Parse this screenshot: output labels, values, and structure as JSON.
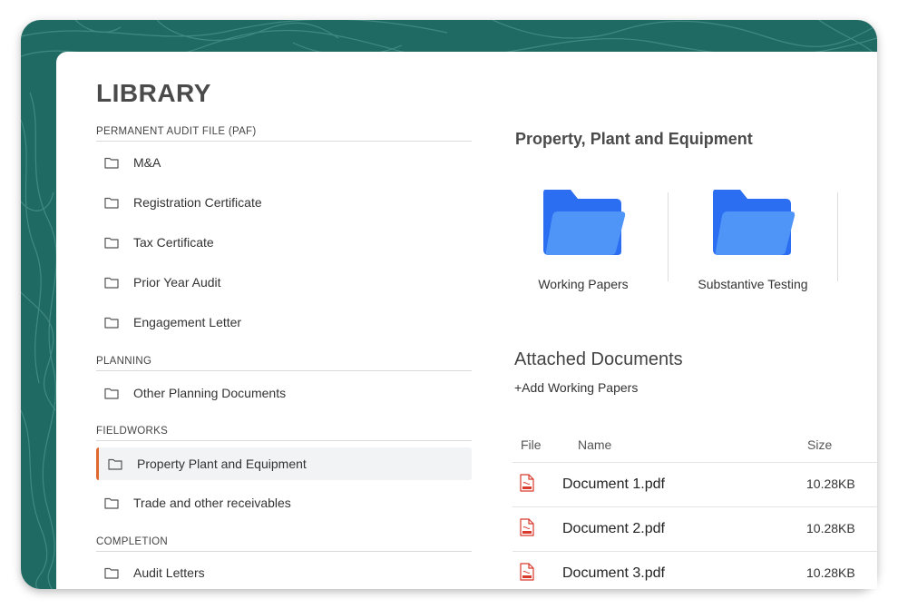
{
  "library": {
    "title": "LIBRARY",
    "sections": [
      {
        "heading": "PERMANENT AUDIT FILE (PAF)",
        "items": [
          "M&A",
          "Registration Certificate",
          "Tax Certificate",
          "Prior Year Audit",
          "Engagement Letter"
        ]
      },
      {
        "heading": "PLANNING",
        "items": [
          "Other Planning Documents"
        ]
      },
      {
        "heading": "FIELDWORKS",
        "items": [
          "Property Plant and Equipment",
          "Trade and other receivables"
        ],
        "active_item": "Property Plant and Equipment"
      },
      {
        "heading": "COMPLETION",
        "items": [
          "Audit Letters"
        ]
      }
    ]
  },
  "detail": {
    "title": "Property, Plant and Equipment",
    "folders": [
      "Working Papers",
      "Substantive Testing"
    ],
    "attached_title": "Attached Documents",
    "add_label": "+Add Working Papers",
    "table": {
      "headers": {
        "file": "File",
        "name": "Name",
        "size": "Size"
      },
      "rows": [
        {
          "name": "Document 1.pdf",
          "size": "10.28KB"
        },
        {
          "name": "Document 2.pdf",
          "size": "10.28KB"
        },
        {
          "name": "Document 3.pdf",
          "size": "10.28KB"
        }
      ]
    }
  },
  "colors": {
    "frame_bg": "#1f6b64",
    "accent_active": "#e0692f",
    "folder_blue": "#3b82f6",
    "pdf_red": "#d8392b"
  },
  "icons": {
    "small_folder": "folder-outline-icon",
    "big_folder": "folder-icon",
    "document": "pdf-file-icon"
  }
}
